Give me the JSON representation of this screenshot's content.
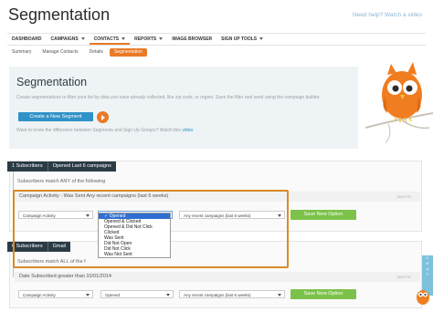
{
  "page": {
    "title": "Segmentation",
    "help_text": "Need help? Watch a video"
  },
  "topnav": [
    {
      "label": "DASHBOARD"
    },
    {
      "label": "CAMPAIGNS"
    },
    {
      "label": "CONTACTS"
    },
    {
      "label": "REPORTS"
    },
    {
      "label": "IMAGE BROWSER"
    },
    {
      "label": "SIGN UP TOOLS"
    }
  ],
  "subnav": [
    {
      "label": "Summary"
    },
    {
      "label": "Manage Contacts"
    },
    {
      "label": "Details"
    },
    {
      "label": "Segmentation"
    }
  ],
  "hero": {
    "title": "Segmentation",
    "description": "Create segmentations to filter your list by data you have already collected, like zip code, or region. Save the filter and send using the campaign builder.",
    "create_button": "Create a New Segment",
    "question": "Want to know the difference between Segments and Sign Up Groups? Watch this ",
    "question_link": "video"
  },
  "segment1": {
    "count": "1 Subscribers",
    "name": "Opened Last 6 campaigns",
    "match": "Subscribers match ANY of the following",
    "condition": "Campaign Activity - Was Sent Any recent campaigns (last 6 weeks)",
    "delete": "DELETE",
    "field_select": "Campaign Activity",
    "op_select": "Opened",
    "range_select": "Any recent campaigns (last 6 weeks)",
    "save_button": "Save New Option"
  },
  "dropdown_options": [
    {
      "label": "✓ Opened"
    },
    {
      "label": "Opened & Clicked"
    },
    {
      "label": "Opened & Did Not Click"
    },
    {
      "label": "Clicked"
    },
    {
      "label": "Was Sent"
    },
    {
      "label": "Did Not Open"
    },
    {
      "label": "Did Not Click"
    },
    {
      "label": "Was Not Sent"
    }
  ],
  "segment2": {
    "count": "6 Subscribers",
    "name": "Gmail",
    "match": "Subscribers match ALL of the f",
    "condition": "Date Subscribed greater than 10/01/2014",
    "delete": "DELETE",
    "field_select": "Campaign Activity",
    "op_select": "Opened",
    "range_select": "Any recent campaigns (last 6 weeks)",
    "save_button": "Save New Option"
  },
  "chat": {
    "letters": [
      "C",
      "H",
      "A",
      "T"
    ]
  },
  "colors": {
    "accent": "#e97a26",
    "primary": "#2f92c8",
    "nav_dark": "#2b3b45",
    "success": "#7cc24a"
  }
}
